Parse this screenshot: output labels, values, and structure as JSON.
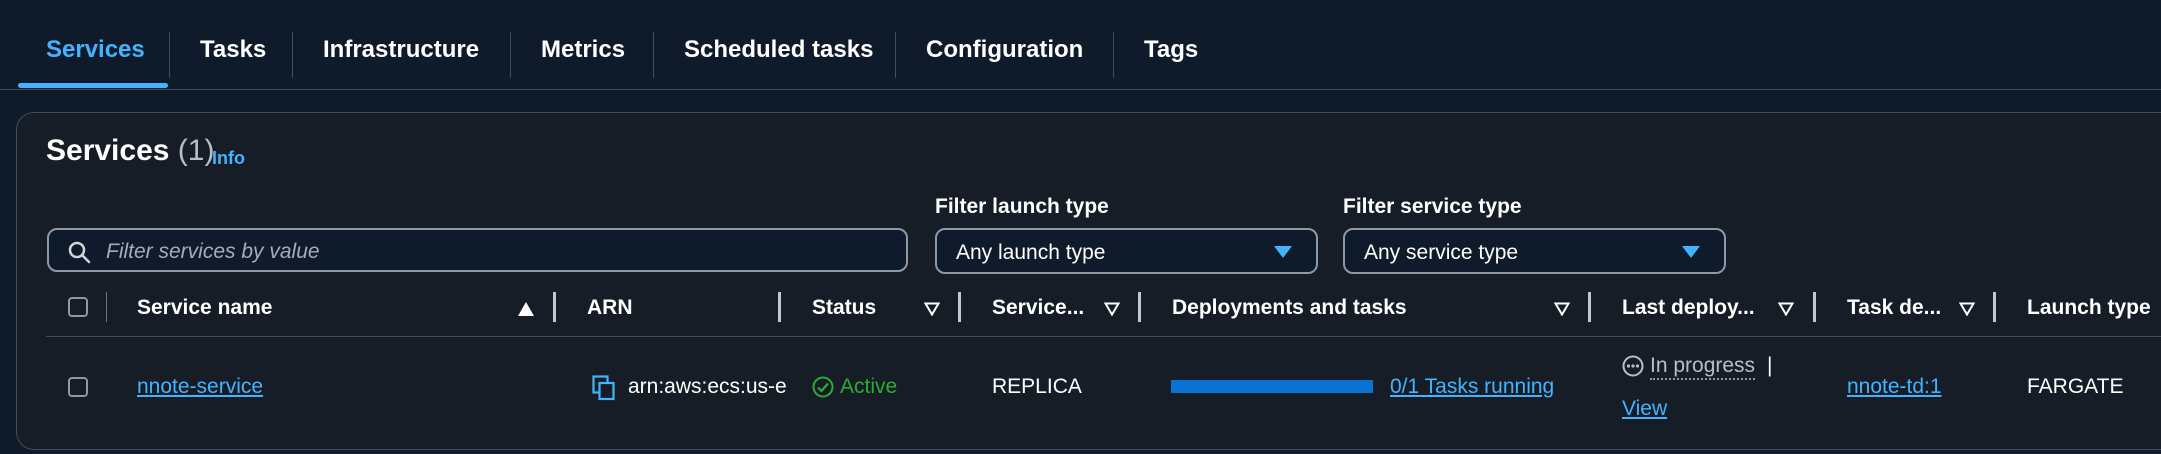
{
  "tabs": [
    {
      "label": "Services",
      "active": true
    },
    {
      "label": "Tasks"
    },
    {
      "label": "Infrastructure"
    },
    {
      "label": "Metrics"
    },
    {
      "label": "Scheduled tasks"
    },
    {
      "label": "Configuration"
    },
    {
      "label": "Tags"
    }
  ],
  "services_panel": {
    "title": "Services",
    "count": "(1)",
    "info_link": "Info",
    "search": {
      "placeholder": "Filter services by value",
      "value": ""
    },
    "launch_filter": {
      "label": "Filter launch type",
      "selected": "Any launch type"
    },
    "service_filter": {
      "label": "Filter service type",
      "selected": "Any service type"
    }
  },
  "table": {
    "columns": [
      {
        "label": "Service name",
        "sort": "ascending"
      },
      {
        "label": "ARN"
      },
      {
        "label": "Status"
      },
      {
        "label": "Service..."
      },
      {
        "label": "Deployments and tasks"
      },
      {
        "label": "Last deploy..."
      },
      {
        "label": "Task de..."
      },
      {
        "label": "Launch type"
      }
    ],
    "rows": [
      {
        "service_name": "nnote-service",
        "arn": "arn:aws:ecs:us-e",
        "status": "Active",
        "service_type": "REPLICA",
        "tasks_progress": 0,
        "tasks_text": "0/1 Tasks running",
        "last_deployment_status": "In progress",
        "last_deployment_separator": "|",
        "last_deployment_link": "View",
        "task_definition": "nnote-td:1",
        "launch_type": "FARGATE"
      }
    ]
  },
  "colors": {
    "background": "#0f1b2a",
    "panel": "#161d26",
    "accent": "#42b4ff",
    "active_status": "#29ad32",
    "progress": "#0972d3"
  }
}
